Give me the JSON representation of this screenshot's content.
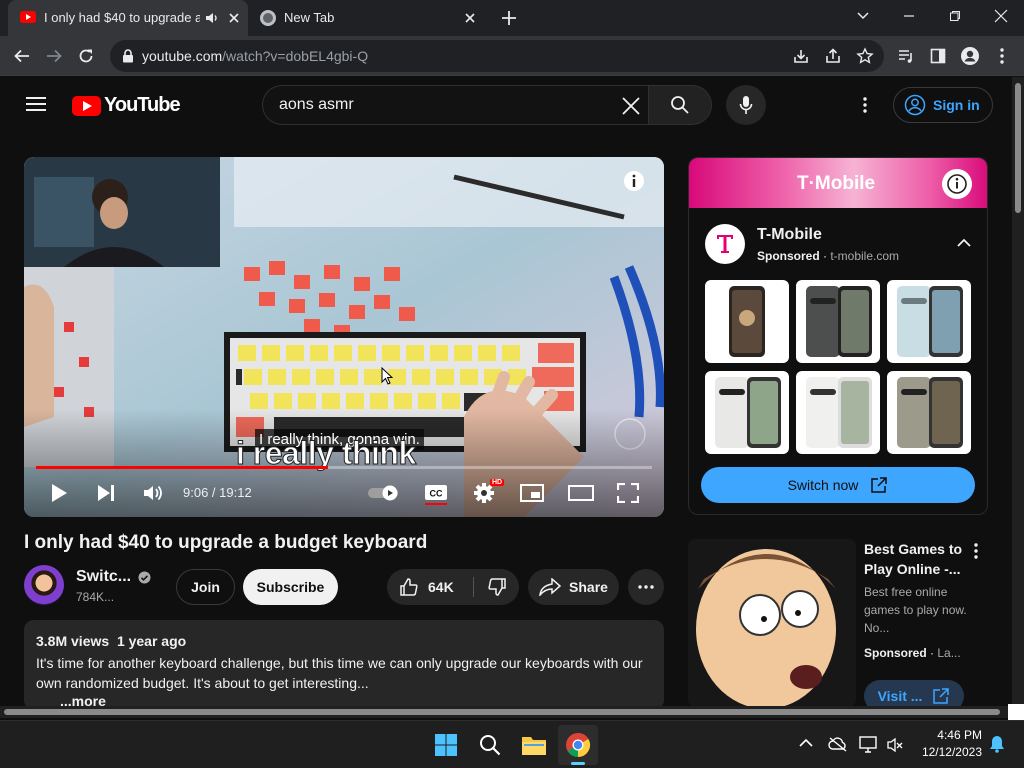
{
  "browser": {
    "tabs": [
      {
        "title": "I only had $40 to upgrade a",
        "audio": "speaker-icon"
      },
      {
        "title": "New Tab"
      }
    ],
    "url_host": "youtube.com",
    "url_path": "/watch?v=dobEL4gbi-Q"
  },
  "youtube": {
    "logo_text": "YouTube",
    "search_value": "aons asmr",
    "sign_in_label": "Sign in",
    "colors": {
      "brand_red": "#ff0000",
      "link_blue": "#3ea6ff"
    }
  },
  "player": {
    "caption_small": "I really think, gonna win.",
    "caption_large": "i really think",
    "time": "9:06 / 19:12",
    "progress_fraction": 0.474,
    "hd_badge": "HD"
  },
  "ad_panel": {
    "brand": "T·Mobile",
    "advertiser": "T-Mobile",
    "sponsored_label": "Sponsored",
    "domain": "t-mobile.com",
    "cta": "Switch now"
  },
  "video": {
    "title": "I only had $40 to upgrade a budget keyboard",
    "channel_name": "Switc...",
    "subscribers": "784K...",
    "join_label": "Join",
    "subscribe_label": "Subscribe",
    "likes": "64K",
    "share_label": "Share",
    "views": "3.8M views",
    "age": "1 year ago",
    "description": "It's time for another keyboard challenge, but this time we can only upgrade our keyboards with our own randomized budget. It's about to get interesting...",
    "more_label": "...more"
  },
  "sidebar_ad": {
    "title": "Best Games to Play Online -...",
    "body": "Best free online games to play now. No...",
    "sponsored_label": "Sponsored",
    "source": "La...",
    "cta": "Visit ..."
  },
  "taskbar": {
    "time": "4:46 PM",
    "date": "12/12/2023"
  }
}
